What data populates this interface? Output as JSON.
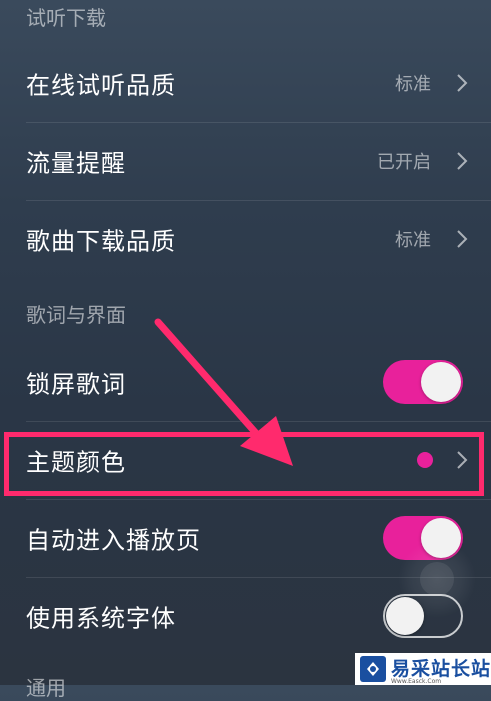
{
  "sections": {
    "download": {
      "header": "试听下载"
    },
    "lyrics_ui": {
      "header": "歌词与界面"
    },
    "general": {
      "header": "通用"
    }
  },
  "rows": {
    "online_quality": {
      "label": "在线试听品质",
      "value": "标准"
    },
    "data_alert": {
      "label": "流量提醒",
      "value": "已开启"
    },
    "download_quality": {
      "label": "歌曲下载品质",
      "value": "标准"
    },
    "lockscreen_lyrics": {
      "label": "锁屏歌词",
      "toggle": "on"
    },
    "theme_color": {
      "label": "主题颜色",
      "color": "#e8219b"
    },
    "auto_play_page": {
      "label": "自动进入播放页",
      "toggle": "on"
    },
    "system_font": {
      "label": "使用系统字体",
      "toggle": "off"
    }
  },
  "colors": {
    "accent": "#e8219b",
    "annotation": "#ff2a6d"
  },
  "watermark": {
    "text": "易采站长站",
    "sub": "Www.Easck.Com"
  }
}
